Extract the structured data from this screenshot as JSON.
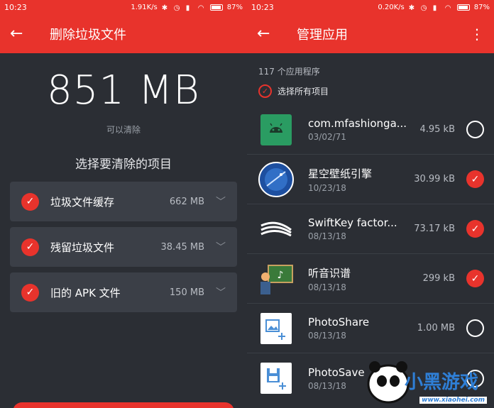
{
  "left": {
    "statusbar": {
      "time": "10:23",
      "speed": "1.91K/s",
      "battery": "87%"
    },
    "toolbar": {
      "back": "←",
      "title": "删除垃圾文件"
    },
    "total": "851 MB",
    "subtitle": "可以清除",
    "section_title": "选择要清除的项目",
    "items": [
      {
        "label": "垃圾文件缓存",
        "size": "662 MB"
      },
      {
        "label": "残留垃圾文件",
        "size": "38.45 MB"
      },
      {
        "label": "旧的 APK 文件",
        "size": "150 MB"
      }
    ]
  },
  "right": {
    "statusbar": {
      "time": "10:23",
      "speed": "0.20K/s",
      "battery": "87%"
    },
    "toolbar": {
      "back": "←",
      "title": "管理应用",
      "more": "⋮"
    },
    "count": "117 个应用程序",
    "select_all": "选择所有项目",
    "apps": [
      {
        "name": "com.mfashionga...",
        "date": "03/02/71",
        "size": "4.95 kB",
        "selected": false,
        "icon": "android-icon"
      },
      {
        "name": "星空壁纸引擎",
        "date": "10/23/18",
        "size": "30.99 kB",
        "selected": true,
        "icon": "starry-wallpaper-icon"
      },
      {
        "name": "SwiftKey factor...",
        "date": "08/13/18",
        "size": "73.17 kB",
        "selected": true,
        "icon": "swiftkey-icon"
      },
      {
        "name": "听音识谱",
        "date": "08/13/18",
        "size": "299 kB",
        "selected": true,
        "icon": "music-teacher-icon"
      },
      {
        "name": "PhotoShare",
        "date": "08/13/18",
        "size": "1.00 MB",
        "selected": false,
        "icon": "photo-share-icon"
      },
      {
        "name": "PhotoSave",
        "date": "08/13/18",
        "size": "",
        "selected": false,
        "icon": "photo-save-icon"
      }
    ]
  },
  "watermark": {
    "brand": "小黑游戏",
    "url": "www.xiaohei.com"
  },
  "colors": {
    "accent": "#e8332c",
    "background": "#2b2e34",
    "card": "#3b3f47"
  }
}
